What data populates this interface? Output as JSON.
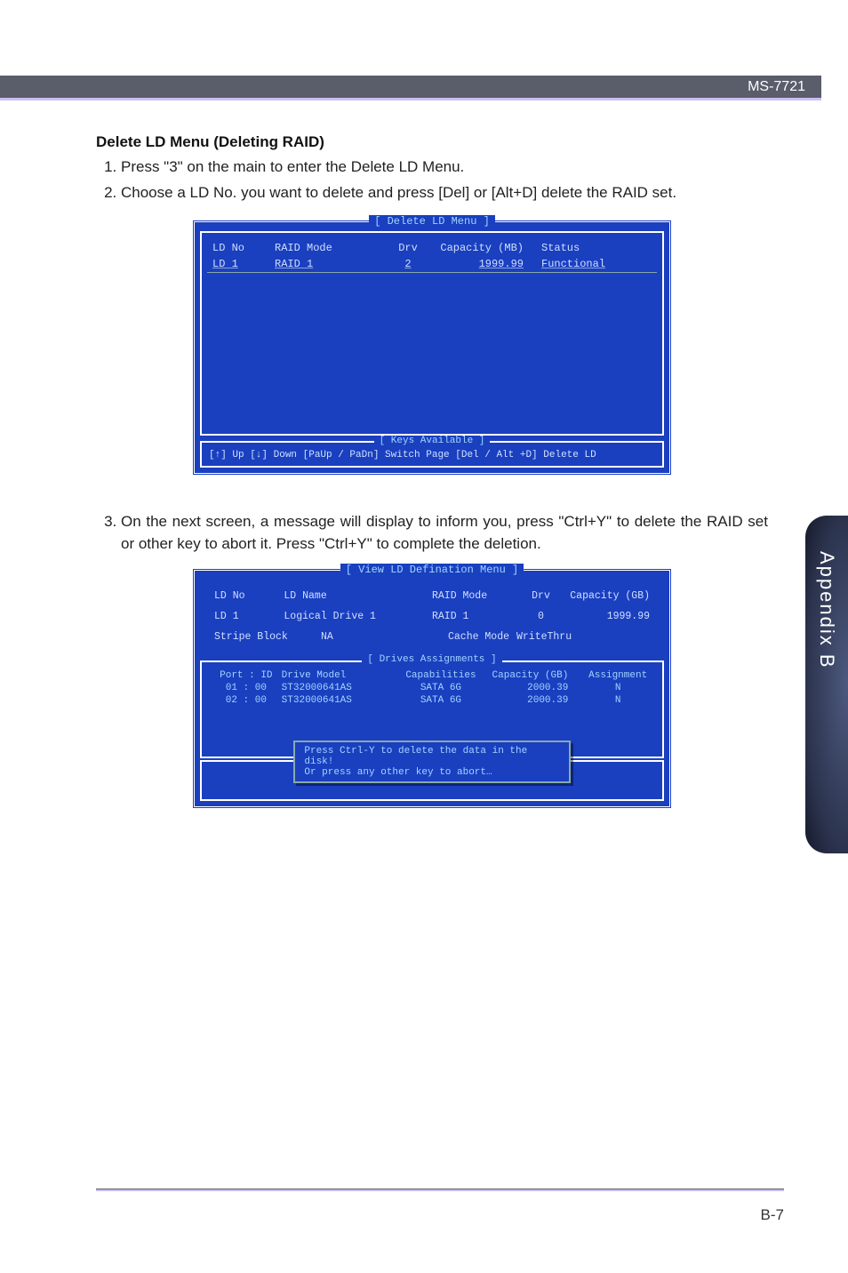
{
  "header": {
    "doc_id": "MS-7721"
  },
  "side_tab": {
    "label": "Appendix B"
  },
  "section": {
    "heading": "Delete LD Menu (Deleting RAID)",
    "steps": [
      "Press \"3\" on the main to enter the Delete LD Menu.",
      "Choose a LD No. you want to delete and press [Del] or [Alt+D] delete the RAID set.",
      "On the next screen, a message will display to inform you, press \"Ctrl+Y\" to delete the RAID set or other key to abort it. Press \"Ctrl+Y\" to complete the deletion."
    ]
  },
  "bios1": {
    "title": "[ Delete LD Menu ]",
    "columns": {
      "ldno": "LD No",
      "mode": "RAID Mode",
      "drv": "Drv",
      "cap": "Capacity (MB)",
      "status": "Status"
    },
    "row": {
      "ldno": "LD  1",
      "mode": "RAID 1",
      "drv": "2",
      "cap": "1999.99",
      "status": "Functional"
    },
    "keys": {
      "title": "[ Keys Available ]",
      "text": "[↑] Up   [↓] Down   [PaUp / PaDn] Switch Page   [Del / Alt +D] Delete LD"
    }
  },
  "bios2": {
    "title": "[ View LD Defination Menu ]",
    "summary": {
      "labels": {
        "ldno": "LD No",
        "ldname": "LD Name",
        "rmode": "RAID Mode",
        "drv": "Drv",
        "cap": "Capacity (GB)",
        "stripe": "Stripe Block",
        "cache": "Cache Mode"
      },
      "values": {
        "ldno": "LD  1",
        "ldname": "Logical Drive 1",
        "rmode": "RAID 1",
        "drv": "0",
        "cap": "1999.99",
        "stripe": "NA",
        "cache": "WriteThru"
      }
    },
    "assign": {
      "title": "[ Drives Assignments ]",
      "columns": {
        "port": "Port : ID",
        "model": "Drive Model",
        "caps": "Capabilities",
        "cap": "Capacity (GB)",
        "asgn": "Assignment"
      },
      "rows": [
        {
          "port": "01 : 00",
          "model": "ST32000641AS",
          "caps": "SATA 6G",
          "cap": "2000.39",
          "asgn": "N"
        },
        {
          "port": "02 : 00",
          "model": "ST32000641AS",
          "caps": "SATA 6G",
          "cap": "2000.39",
          "asgn": "N"
        }
      ]
    },
    "confirm": {
      "line1": "Press Ctrl-Y to delete the data in the disk!",
      "line2": "Or press any other key to abort…"
    }
  },
  "footer": {
    "page": "B-7"
  }
}
